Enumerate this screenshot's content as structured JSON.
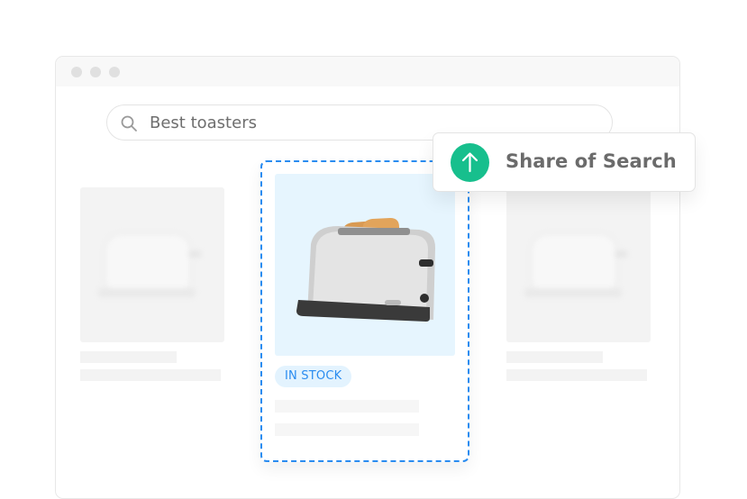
{
  "window": {
    "controls": [
      "close-dot",
      "minimize-dot",
      "maximize-dot"
    ]
  },
  "search": {
    "icon": "search-icon",
    "value": "Best toasters"
  },
  "products": [
    {
      "state": "placeholder",
      "image": "toaster-blurred"
    },
    {
      "state": "highlighted",
      "image": "toaster",
      "badge": "IN STOCK"
    },
    {
      "state": "placeholder",
      "image": "toaster-blurred"
    }
  ],
  "popover": {
    "icon": "arrow-up-icon",
    "label": "Share of Search"
  },
  "colors": {
    "accent_blue": "#2a8cf0",
    "success_green": "#17bf8d",
    "highlight_bg": "#e6f5fe",
    "placeholder_gray": "#f3f3f3"
  }
}
